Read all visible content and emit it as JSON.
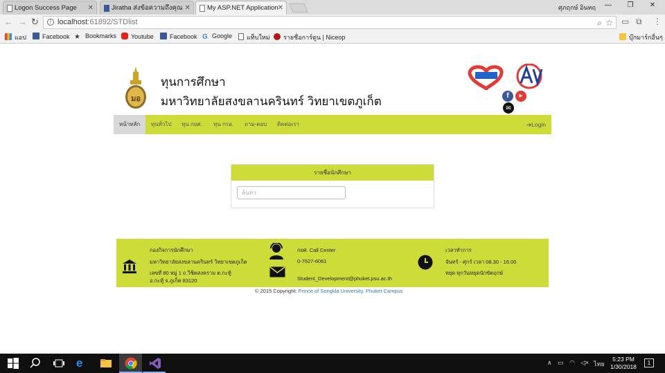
{
  "browser": {
    "tabs": [
      {
        "title": "Logon Success Page"
      },
      {
        "title": "Jiratha ส่งข้อความถึงคุณ"
      },
      {
        "title": "My ASP.NET Application"
      }
    ],
    "profile_name": "ศุภฤกษ์ อินทฤ",
    "url_host": "localhost",
    "url_path": ":61892/STDlist",
    "bookmarks": [
      {
        "label": "แอป",
        "icon": "apps-icon"
      },
      {
        "label": "Facebook",
        "icon": "facebook-icon"
      },
      {
        "label": "Bookmarks",
        "icon": "star-icon"
      },
      {
        "label": "Youtube",
        "icon": "youtube-icon"
      },
      {
        "label": "Facebook",
        "icon": "facebook-icon"
      },
      {
        "label": "Google",
        "icon": "google-icon"
      },
      {
        "label": "แท็บใหม่",
        "icon": "page-icon"
      },
      {
        "label": "รายชื่อการ์ตูน | Niceop",
        "icon": "site-icon"
      }
    ],
    "other_bookmarks": "บุ๊กมาร์กอื่นๆ"
  },
  "site": {
    "title_line1": "ทุนการศึกษา",
    "title_line2": "มหาวิทยาลัยสงขลานครินทร์ วิทยาเขตภูเก็ต",
    "nav": [
      "หน้าหลัก",
      "ทุนทั่วไป",
      "ทุน กยศ.",
      "ทุน กรอ.",
      "ถาม-ตอบ",
      "ติดต่อเรา"
    ],
    "login": "Login",
    "panel_title": "รายชื่อนักศึกษา",
    "search_placeholder": "ค้นหา",
    "footer": {
      "org_title": "กองกิจการนักศึกษา",
      "org_name": "มหาวิทยาลัยสงขลานครินทร์ วิทยาเขตภูเก็ต",
      "org_addr1": "เลขที่ 80 หมู่ 1 ถ.วิชิตสงคราม ต.กะทู้",
      "org_addr2": "อ.กะทู้ จ.ภูเก็ต 83120",
      "call_center": "กยศ. Call Center",
      "phone": "0-7627-6061",
      "email": "Student_Development@phuket.psu.ac.th",
      "hours_title": "เวลาทำการ",
      "hours": "จันทร์ - ศุกร์ เวลา 08.30 - 16.00",
      "holiday": "หยุด ทุกวันหยุดนักขัตฤกษ์"
    },
    "copyright_prefix": "© 2015 Copyright:",
    "copyright_link": "Prince of Songkla University, Phuket Campus"
  },
  "taskbar": {
    "time": "5:23 PM",
    "date": "1/30/2018",
    "lang": "ไทย",
    "notif_count": "1"
  },
  "colors": {
    "accent": "#cddc39",
    "link": "#337ab7"
  }
}
